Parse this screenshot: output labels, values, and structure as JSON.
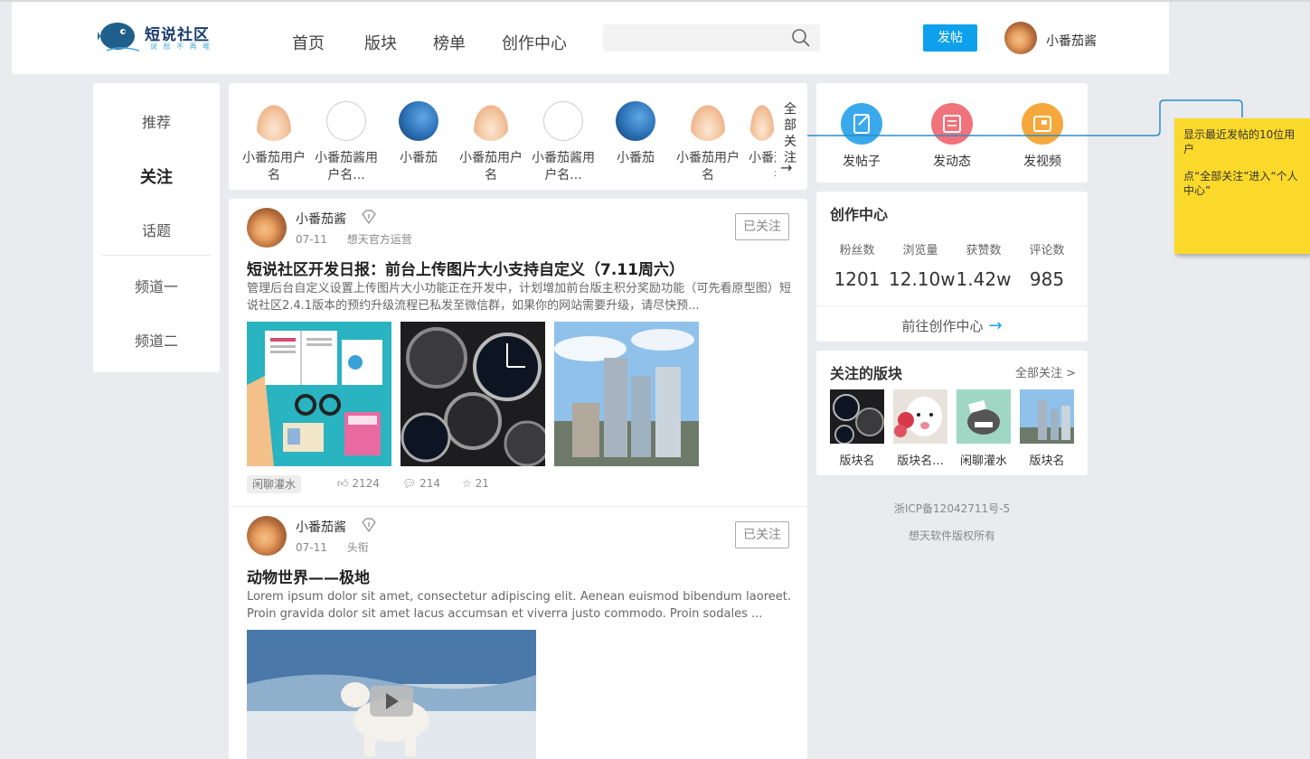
{
  "header": {
    "logo_title": "短说社区",
    "logo_subtitle": "说 愁 不 再 唯",
    "nav": [
      "首页",
      "版块",
      "榜单",
      "创作中心"
    ],
    "search_placeholder": "",
    "post_button": "发帖",
    "user_name": "小番茄酱"
  },
  "left_nav": {
    "items": [
      "推荐",
      "关注",
      "话题",
      "频道一",
      "频道二"
    ],
    "active": "关注"
  },
  "follow_strip": {
    "users": [
      {
        "name": "小番茄用户名",
        "avatar": "bear"
      },
      {
        "name": "小番茄酱用户名...",
        "avatar": "sketch"
      },
      {
        "name": "小番茄",
        "avatar": "blue"
      },
      {
        "name": "小番茄用户名",
        "avatar": "bear"
      },
      {
        "name": "小番茄酱用户名...",
        "avatar": "sketch"
      },
      {
        "name": "小番茄",
        "avatar": "blue"
      },
      {
        "name": "小番茄用户名",
        "avatar": "bear"
      },
      {
        "name": "小番茄用户名",
        "avatar": "bear"
      }
    ],
    "all_follow_label": "全部关注"
  },
  "posts": [
    {
      "author": "小番茄酱",
      "date": "07-11",
      "source": "想天官方运营",
      "follow_label": "已关注",
      "title": "短说社区开发日报：前台上传图片大小支持自定义（7.11周六）",
      "body": "管理后台自定义设置上传图片大小功能正在开发中，计划增加前台版主积分奖励功能（可先看原型图）短说社区2.4.1版本的预约升级流程已私发至微信群，如果你的网站需要升级，请尽快预...",
      "tag": "闲聊灌水",
      "likes": "2124",
      "comments": "214",
      "favorites": "21"
    },
    {
      "author": "小番茄酱",
      "date": "07-11",
      "source": "头衔",
      "follow_label": "已关注",
      "title": "动物世界——极地",
      "body": "Lorem ipsum dolor sit amet, consectetur adipiscing elit. Aenean euismod bibendum laoreet. Proin gravida dolor sit amet lacus accumsan et viverra justo commodo. Proin sodales ..."
    }
  ],
  "quick_actions": [
    {
      "label": "发帖子",
      "color": "#3aa9ec",
      "icon": "edit-icon"
    },
    {
      "label": "发动态",
      "color": "#f0727a",
      "icon": "news-icon"
    },
    {
      "label": "发视频",
      "color": "#f6a83c",
      "icon": "video-icon"
    }
  ],
  "creation_center": {
    "title": "创作中心",
    "stats": [
      {
        "label": "粉丝数",
        "value": "1201"
      },
      {
        "label": "浏览量",
        "value": "12.10w"
      },
      {
        "label": "获赞数",
        "value": "1.42w"
      },
      {
        "label": "评论数",
        "value": "985"
      }
    ],
    "link_label": "前往创作中心"
  },
  "followed_boards": {
    "title": "关注的版块",
    "all_label": "全部关注 >",
    "boards": [
      {
        "name": "版块名",
        "image": "clocks"
      },
      {
        "name": "版块名...",
        "image": "dog"
      },
      {
        "name": "闲聊灌水",
        "image": "cartoon"
      },
      {
        "name": "版块名",
        "image": "city"
      }
    ]
  },
  "footer": {
    "icp": "浙ICP备12042711号-5",
    "copyright": "想天软件版权所有"
  },
  "annotation": {
    "line1": "显示最近发帖的10位用户",
    "line2": "点“全部关注”进入“个人中心”"
  },
  "colors": {
    "accent": "#0da1eb",
    "note": "#fbd92b"
  }
}
